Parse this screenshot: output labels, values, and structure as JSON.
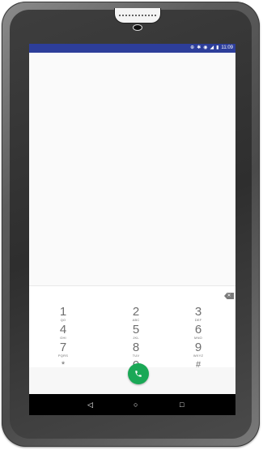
{
  "status_bar": {
    "icons": [
      "signal-icon",
      "bluetooth-icon",
      "wifi-icon",
      "network-icon",
      "battery-icon"
    ],
    "time": "11:09",
    "color": "#2d3e9a"
  },
  "dialpad": {
    "keys": [
      {
        "num": "1",
        "letters": "QO"
      },
      {
        "num": "2",
        "letters": "ABC"
      },
      {
        "num": "3",
        "letters": "DEF"
      },
      {
        "num": "4",
        "letters": "GHI"
      },
      {
        "num": "5",
        "letters": "JKL"
      },
      {
        "num": "6",
        "letters": "MNO"
      },
      {
        "num": "7",
        "letters": "PQRS"
      },
      {
        "num": "8",
        "letters": "TUV"
      },
      {
        "num": "9",
        "letters": "WXYZ"
      },
      {
        "num": "*",
        "letters": ""
      },
      {
        "num": "0",
        "letters": "+"
      },
      {
        "num": "#",
        "letters": ""
      }
    ]
  },
  "call_button": {
    "icon": "phone-icon",
    "color": "#1aa856"
  },
  "nav_bar": {
    "back": "◁",
    "home": "○",
    "recents": "□"
  }
}
